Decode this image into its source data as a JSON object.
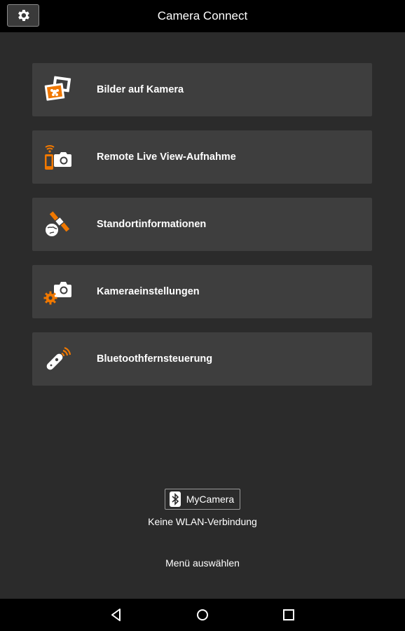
{
  "header": {
    "title": "Camera Connect"
  },
  "menu": {
    "items": [
      {
        "label": "Bilder auf Kamera",
        "icon": "photos-icon"
      },
      {
        "label": "Remote Live View-Aufnahme",
        "icon": "remote-shooting-icon"
      },
      {
        "label": "Standortinformationen",
        "icon": "satellite-location-icon"
      },
      {
        "label": "Kameraeinstellungen",
        "icon": "camera-settings-icon"
      },
      {
        "label": "Bluetoothfernsteuerung",
        "icon": "bluetooth-remote-icon"
      }
    ]
  },
  "status": {
    "camera_name": "MyCamera",
    "wlan": "Keine WLAN-Verbindung"
  },
  "hint": "Menü auswählen",
  "colors": {
    "accent": "#f07800",
    "background": "#2b2b2b",
    "card": "#3e3e3e",
    "bar": "#000000"
  }
}
